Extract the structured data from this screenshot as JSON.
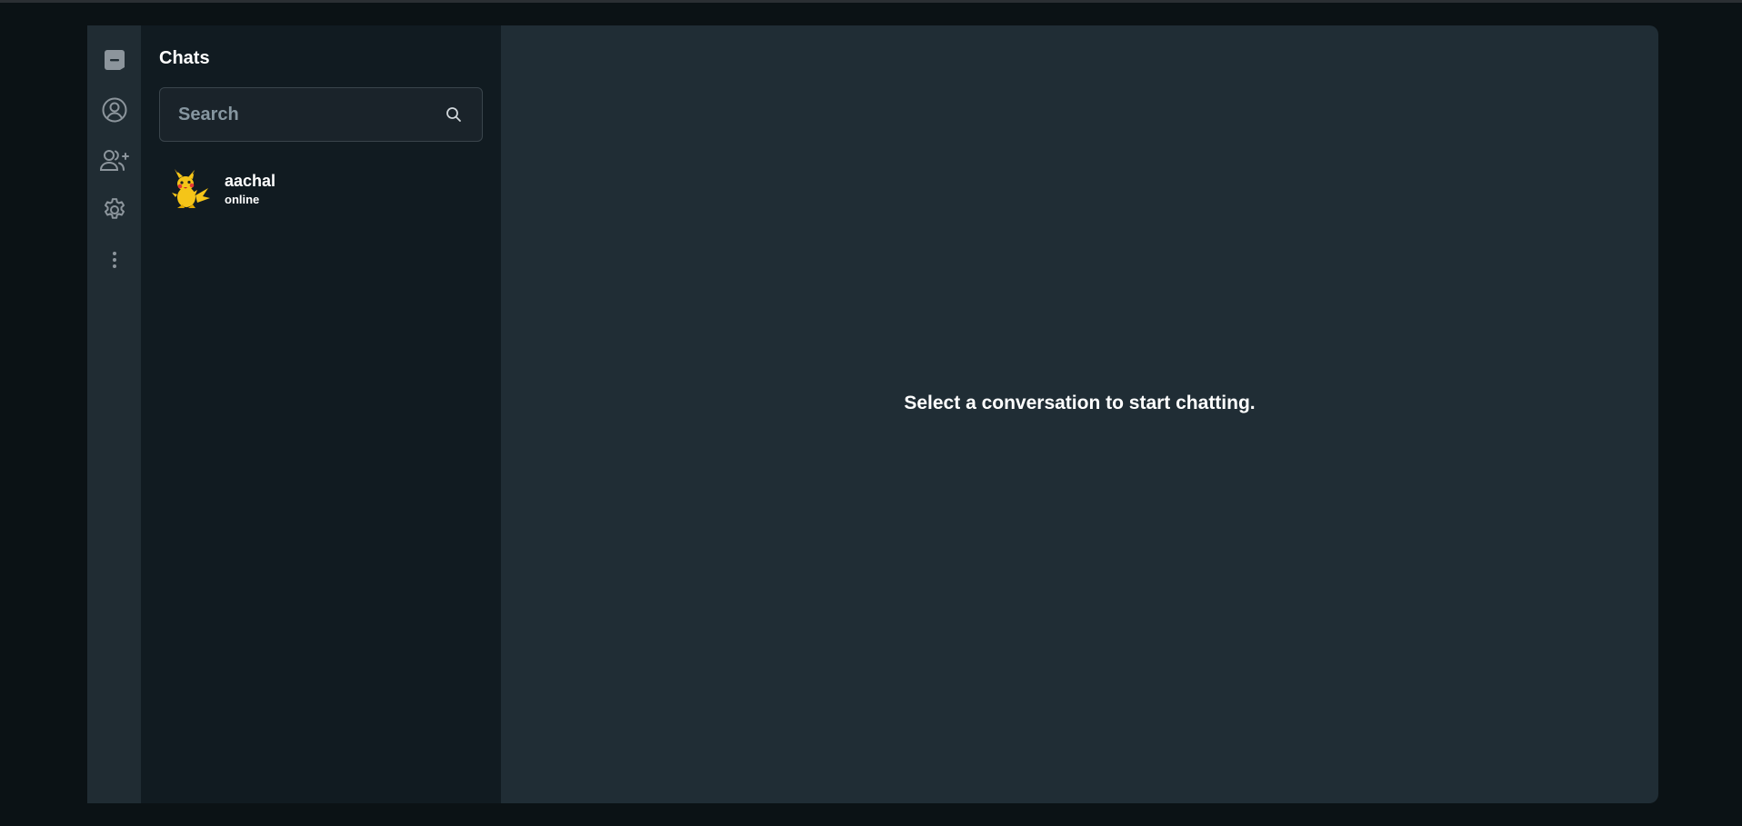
{
  "sidebar_nav": {
    "items": [
      {
        "icon": "chat-bubble-icon",
        "label": ""
      },
      {
        "icon": "profile-icon",
        "label": ""
      },
      {
        "icon": "add-user-icon",
        "label": ""
      },
      {
        "icon": "gear-icon",
        "label": ""
      },
      {
        "icon": "more-vertical-icon",
        "label": ""
      }
    ]
  },
  "chats_panel": {
    "title": "Chats",
    "search": {
      "placeholder": "Search",
      "value": ""
    },
    "conversations": [
      {
        "name": "aachal",
        "status": "online",
        "avatar": "pikachu-avatar"
      }
    ]
  },
  "main": {
    "empty_message": "Select a conversation to start chatting."
  },
  "colors": {
    "page_bg": "#0b1215",
    "rail_bg": "#202c33",
    "panel_bg": "#111b21",
    "main_bg": "#202d35",
    "icon": "#8c959c",
    "text": "#ffffff"
  }
}
